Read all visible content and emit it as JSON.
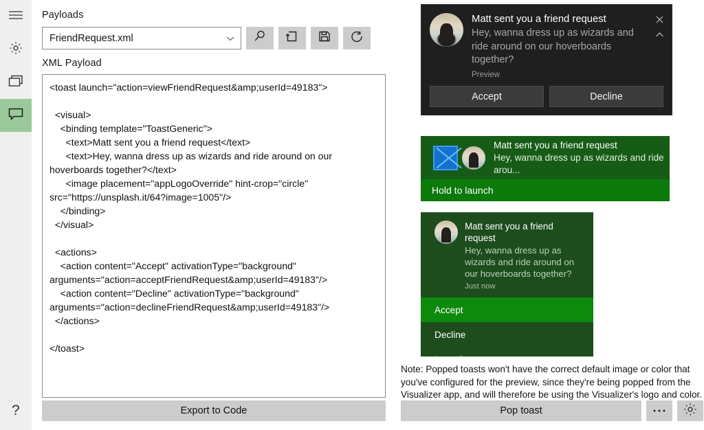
{
  "rail": {
    "items": [
      {
        "icon": "hamburger-menu-icon",
        "name": "menu"
      },
      {
        "icon": "gear-icon",
        "name": "settings"
      },
      {
        "icon": "tiles-icon",
        "name": "tiles"
      },
      {
        "icon": "chat-bubble-icon",
        "name": "toasts"
      }
    ],
    "help_icon": "question-mark-icon",
    "selected_index": 3,
    "selected_color": "#9bc99b"
  },
  "left": {
    "payloads_label": "Payloads",
    "combo_value": "FriendRequest.xml",
    "combo_chevron": "chevron-down-icon",
    "tools": [
      {
        "name": "search-button",
        "icon": "magnifier-icon"
      },
      {
        "name": "open-button",
        "icon": "open-file-icon"
      },
      {
        "name": "save-button",
        "icon": "floppy-disk-icon"
      },
      {
        "name": "refresh-button",
        "icon": "refresh-icon"
      }
    ],
    "xml_label": "XML Payload",
    "xml_payload": "<toast launch=\"action=viewFriendRequest&amp;userId=49183\">\n\n  <visual>\n    <binding template=\"ToastGeneric\">\n      <text>Matt sent you a friend request</text>\n      <text>Hey, wanna dress up as wizards and ride around on our hoverboards together?</text>\n      <image placement=\"appLogoOverride\" hint-crop=\"circle\" src=\"https://unsplash.it/64?image=1005\"/>\n    </binding>\n  </visual>\n\n  <actions>\n    <action content=\"Accept\" activationType=\"background\" arguments=\"action=acceptFriendRequest&amp;userId=49183\"/>\n    <action content=\"Decline\" activationType=\"background\" arguments=\"action=declineFriendRequest&amp;userId=49183\"/>\n  </actions>\n\n</toast>",
    "export_label": "Export to Code"
  },
  "toast_preview": {
    "title": "Matt sent you a friend request",
    "body": "Hey, wanna dress up as wizards and ride around on our hoverboards together?",
    "attribution": "Preview",
    "close_icon": "close-icon",
    "collapse_icon": "chevron-up-icon",
    "avatar_icon": "avatar",
    "buttons": [
      {
        "label": "Accept",
        "name": "accept-button"
      },
      {
        "label": "Decline",
        "name": "decline-button"
      }
    ],
    "background": "#1f1f1f"
  },
  "toast_banner": {
    "placeholder_icon": "broken-image-icon",
    "avatar_icon": "avatar",
    "title": "Matt sent you a friend request",
    "body": "Hey, wanna dress up as wizards and ride arou...",
    "hold_label": "Hold to launch",
    "background": "#165c16",
    "hold_background": "#0b7a0b"
  },
  "toast_card": {
    "avatar_icon": "avatar",
    "title": "Matt sent you a friend request",
    "body": "Hey, wanna dress up as wizards and ride around on our hoverboards together?",
    "timestamp": "Just now",
    "actions": [
      {
        "label": "Accept",
        "name": "accept-action",
        "active": true
      },
      {
        "label": "Decline",
        "name": "decline-action",
        "active": false
      },
      {
        "label": "Launch",
        "name": "launch-action",
        "active": false
      }
    ],
    "background": "#1d4d1d",
    "active_background": "#0d8a0d"
  },
  "right": {
    "note": "Note: Popped toasts won't have the correct default image or color that you've configured for the preview, since they're being popped from the Visualizer app, and will therefore be using the Visualizer's logo and color.",
    "pop_label": "Pop toast",
    "more_icon": "ellipsis-icon",
    "settings_icon": "gear-icon"
  }
}
